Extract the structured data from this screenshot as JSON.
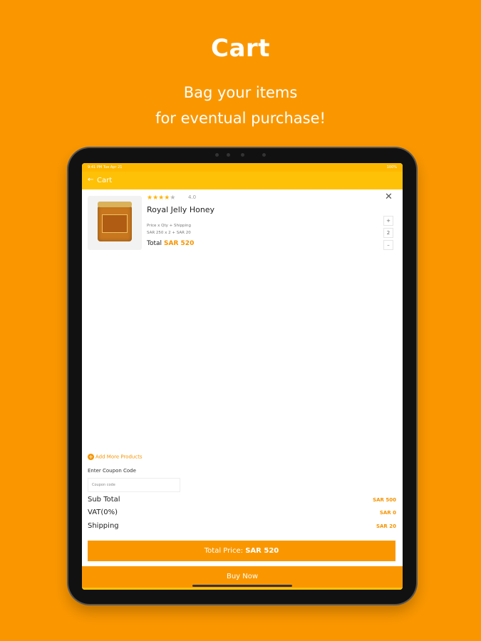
{
  "promo": {
    "title": "Cart",
    "subtitle_line1": "Bag your items",
    "subtitle_line2": "for eventual purchase!"
  },
  "status_bar": {
    "left": "9:41 PM  Tue Apr 21",
    "right": "100%"
  },
  "app_bar": {
    "back_icon": "arrow-left-icon",
    "title": "Cart"
  },
  "cart_item": {
    "rating_stars_filled": 4,
    "rating_stars_total": 5,
    "rating_value": "4.0",
    "name": "Royal Jelly Honey",
    "price_formula": "Price x Qty + Shipping",
    "price_calc": "SAR 250 x 2 + SAR 20",
    "total_label": "Total",
    "total_amount": "SAR 520",
    "quantity": "2",
    "increment_label": "+",
    "decrement_label": "–",
    "remove_label": "✕"
  },
  "add_more": {
    "icon": "plus-circle-icon",
    "label": "Add More Products"
  },
  "coupon": {
    "label": "Enter Coupon Code",
    "placeholder": "Coupon code",
    "value": ""
  },
  "summary": {
    "subtotal_label": "Sub Total",
    "subtotal_value": "SAR 500",
    "vat_label": "VAT(0%)",
    "vat_value": "SAR 0",
    "shipping_label": "Shipping",
    "shipping_value": "SAR 20"
  },
  "total_price": {
    "label": "Total Price:",
    "value": "SAR 520"
  },
  "buy_now_label": "Buy Now",
  "colors": {
    "background": "#fa9700",
    "app_bar": "#ffc107",
    "accent": "#f59400",
    "star": "#ffb300"
  }
}
